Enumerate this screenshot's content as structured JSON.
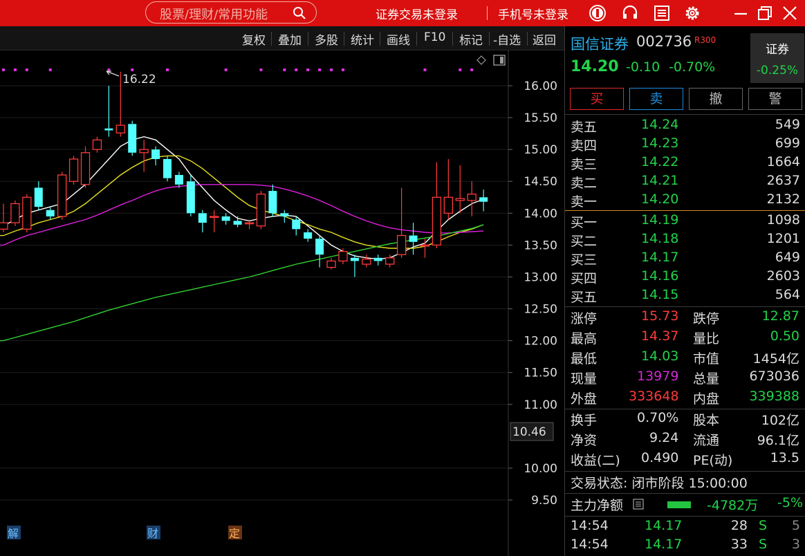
{
  "topbar": {
    "search_placeholder": "股票/理财/常用功能",
    "trade_login": "证券交易未登录",
    "phone_login": "手机号未登录",
    "icons": [
      "logo-icon",
      "headset-icon",
      "menu-icon",
      "gear-icon",
      "minimize-icon",
      "restore-icon",
      "close-icon"
    ]
  },
  "toolbar": {
    "buttons": [
      "复权",
      "叠加",
      "多股",
      "统计",
      "画线",
      "F10",
      "标记",
      "-自选",
      "返回"
    ]
  },
  "chart_data": {
    "type": "candlestick",
    "ylim": [
      9.3,
      16.5
    ],
    "y_ticks": [
      "16.00",
      "15.50",
      "15.00",
      "14.50",
      "14.00",
      "13.50",
      "13.00",
      "12.50",
      "12.00",
      "11.50",
      "11.00",
      "10.00",
      "9.50"
    ],
    "price_marker": "10.46",
    "high_annotation": "16.22",
    "event_markers": [
      "解",
      "财",
      "定"
    ],
    "candles": [
      {
        "o": 13.75,
        "c": 13.85,
        "h": 14.15,
        "l": 13.7
      },
      {
        "o": 13.85,
        "c": 14.15,
        "h": 14.2,
        "l": 13.8
      },
      {
        "o": 13.75,
        "c": 14.25,
        "h": 14.3,
        "l": 13.7
      },
      {
        "o": 14.4,
        "c": 14.1,
        "h": 14.5,
        "l": 14.05
      },
      {
        "o": 14.05,
        "c": 13.95,
        "h": 14.1,
        "l": 13.9
      },
      {
        "o": 13.95,
        "c": 14.6,
        "h": 14.65,
        "l": 13.9
      },
      {
        "o": 14.5,
        "c": 14.85,
        "h": 14.9,
        "l": 14.45
      },
      {
        "o": 14.45,
        "c": 14.95,
        "h": 15.05,
        "l": 14.4
      },
      {
        "o": 15.0,
        "c": 15.15,
        "h": 15.2,
        "l": 14.95
      },
      {
        "o": 15.33,
        "c": 15.3,
        "h": 16.0,
        "l": 15.2
      },
      {
        "o": 15.26,
        "c": 15.38,
        "h": 16.22,
        "l": 15.2
      },
      {
        "o": 15.4,
        "c": 14.95,
        "h": 15.45,
        "l": 14.9
      },
      {
        "o": 14.95,
        "c": 15.0,
        "h": 15.15,
        "l": 14.65
      },
      {
        "o": 15.0,
        "c": 14.85,
        "h": 15.05,
        "l": 14.75
      },
      {
        "o": 14.85,
        "c": 14.55,
        "h": 14.9,
        "l": 14.5
      },
      {
        "o": 14.6,
        "c": 14.45,
        "h": 14.65,
        "l": 14.4
      },
      {
        "o": 14.5,
        "c": 14.0,
        "h": 14.6,
        "l": 13.95
      },
      {
        "o": 14.0,
        "c": 13.85,
        "h": 14.05,
        "l": 13.7
      },
      {
        "o": 13.95,
        "c": 13.95,
        "h": 14.05,
        "l": 13.7
      },
      {
        "o": 13.95,
        "c": 13.88,
        "h": 14.0,
        "l": 13.82
      },
      {
        "o": 13.88,
        "c": 13.82,
        "h": 13.95,
        "l": 13.78
      },
      {
        "o": 13.85,
        "c": 13.85,
        "h": 13.9,
        "l": 13.75
      },
      {
        "o": 13.8,
        "c": 14.3,
        "h": 14.35,
        "l": 13.75
      },
      {
        "o": 14.35,
        "c": 14.0,
        "h": 14.45,
        "l": 13.95
      },
      {
        "o": 14.0,
        "c": 13.95,
        "h": 14.05,
        "l": 13.85
      },
      {
        "o": 13.9,
        "c": 13.75,
        "h": 13.95,
        "l": 13.65
      },
      {
        "o": 13.7,
        "c": 13.6,
        "h": 13.75,
        "l": 13.55
      },
      {
        "o": 13.6,
        "c": 13.35,
        "h": 13.65,
        "l": 13.15
      },
      {
        "o": 13.15,
        "c": 13.25,
        "h": 13.3,
        "l": 13.12
      },
      {
        "o": 13.25,
        "c": 13.4,
        "h": 13.45,
        "l": 13.2
      },
      {
        "o": 13.3,
        "c": 13.25,
        "h": 13.35,
        "l": 13.0
      },
      {
        "o": 13.2,
        "c": 13.28,
        "h": 13.35,
        "l": 13.15
      },
      {
        "o": 13.3,
        "c": 13.25,
        "h": 13.35,
        "l": 13.18
      },
      {
        "o": 13.2,
        "c": 13.3,
        "h": 13.35,
        "l": 13.15
      },
      {
        "o": 13.35,
        "c": 13.65,
        "h": 14.4,
        "l": 13.3
      },
      {
        "o": 13.65,
        "c": 13.55,
        "h": 13.85,
        "l": 13.35
      },
      {
        "o": 13.5,
        "c": 13.5,
        "h": 13.6,
        "l": 13.3
      },
      {
        "o": 13.5,
        "c": 14.25,
        "h": 14.8,
        "l": 13.45
      },
      {
        "o": 14.0,
        "c": 14.25,
        "h": 14.85,
        "l": 13.9
      },
      {
        "o": 14.2,
        "c": 14.23,
        "h": 14.75,
        "l": 14.0
      },
      {
        "o": 14.2,
        "c": 14.3,
        "h": 14.5,
        "l": 13.95
      },
      {
        "o": 14.25,
        "c": 14.18,
        "h": 14.37,
        "l": 14.03
      }
    ],
    "series": [
      {
        "name": "MA5",
        "color": "#ffffff",
        "values": [
          13.8,
          13.9,
          14.0,
          14.05,
          14.1,
          14.15,
          14.3,
          14.45,
          14.65,
          14.85,
          15.05,
          15.15,
          15.2,
          15.15,
          15.0,
          14.85,
          14.6,
          14.4,
          14.2,
          14.05,
          13.92,
          13.88,
          13.92,
          13.95,
          13.97,
          13.95,
          13.8,
          13.65,
          13.5,
          13.4,
          13.33,
          13.3,
          13.28,
          13.3,
          13.38,
          13.47,
          13.53,
          13.72,
          13.9,
          14.03,
          14.15,
          14.22
        ]
      },
      {
        "name": "MA10",
        "color": "#e8e020",
        "values": [
          13.65,
          13.72,
          13.78,
          13.85,
          13.9,
          13.95,
          14.03,
          14.15,
          14.3,
          14.45,
          14.6,
          14.72,
          14.82,
          14.88,
          14.9,
          14.9,
          14.82,
          14.7,
          14.55,
          14.4,
          14.25,
          14.12,
          14.05,
          14.0,
          13.95,
          13.88,
          13.82,
          13.75,
          13.7,
          13.62,
          13.55,
          13.5,
          13.47,
          13.45,
          13.45,
          13.45,
          13.48,
          13.55,
          13.63,
          13.7,
          13.75,
          13.82
        ]
      },
      {
        "name": "MA20",
        "color": "#e020e0",
        "values": [
          13.5,
          13.58,
          13.65,
          13.7,
          13.75,
          13.8,
          13.85,
          13.9,
          13.97,
          14.05,
          14.13,
          14.2,
          14.28,
          14.35,
          14.4,
          14.42,
          14.44,
          14.45,
          14.45,
          14.45,
          14.45,
          14.45,
          14.44,
          14.42,
          14.38,
          14.33,
          14.27,
          14.2,
          14.12,
          14.03,
          13.95,
          13.88,
          13.82,
          13.77,
          13.74,
          13.72,
          13.7,
          13.69,
          13.69,
          13.7,
          13.71,
          13.72
        ]
      },
      {
        "name": "MA60",
        "color": "#32d232",
        "values": [
          12.0,
          12.05,
          12.1,
          12.15,
          12.2,
          12.25,
          12.3,
          12.36,
          12.42,
          12.48,
          12.53,
          12.58,
          12.63,
          12.68,
          12.72,
          12.76,
          12.8,
          12.84,
          12.88,
          12.92,
          12.96,
          13.0,
          13.05,
          13.1,
          13.15,
          13.2,
          13.24,
          13.28,
          13.32,
          13.36,
          13.4,
          13.44,
          13.48,
          13.52,
          13.55,
          13.58,
          13.61,
          13.64,
          13.68,
          13.72,
          13.76,
          13.82
        ]
      }
    ]
  },
  "quote": {
    "name": "国信证券",
    "code": "002736",
    "tag": "R300",
    "price": "14.20",
    "change": "-0.10",
    "change_pct": "-0.70%",
    "sector_name": "证券",
    "sector_pct": "-0.25%"
  },
  "actions": {
    "buy": "买",
    "sell": "卖",
    "cancel": "撤",
    "alert": "警"
  },
  "order_book": {
    "asks": [
      {
        "label": "卖五",
        "price": "14.24",
        "vol": "549"
      },
      {
        "label": "卖四",
        "price": "14.23",
        "vol": "699"
      },
      {
        "label": "卖三",
        "price": "14.22",
        "vol": "1664"
      },
      {
        "label": "卖二",
        "price": "14.21",
        "vol": "2637"
      },
      {
        "label": "卖一",
        "price": "14.20",
        "vol": "2132"
      }
    ],
    "bids": [
      {
        "label": "买一",
        "price": "14.19",
        "vol": "1098"
      },
      {
        "label": "买二",
        "price": "14.18",
        "vol": "1201"
      },
      {
        "label": "买三",
        "price": "14.17",
        "vol": "649"
      },
      {
        "label": "买四",
        "price": "14.16",
        "vol": "2603"
      },
      {
        "label": "买五",
        "price": "14.15",
        "vol": "564"
      }
    ]
  },
  "stats": {
    "limit_up_label": "涨停",
    "limit_up": "15.73",
    "limit_down_label": "跌停",
    "limit_down": "12.87",
    "high_label": "最高",
    "high": "14.37",
    "vol_ratio_label": "量比",
    "vol_ratio": "0.50",
    "low_label": "最低",
    "low": "14.03",
    "mkt_cap_label": "市值",
    "mkt_cap": "1454亿",
    "cur_vol_label": "现量",
    "cur_vol": "13979",
    "total_vol_label": "总量",
    "total_vol": "673036",
    "outer_label": "外盘",
    "outer": "333648",
    "inner_label": "内盘",
    "inner": "339388",
    "turnover_label": "换手",
    "turnover": "0.70%",
    "share_cap_label": "股本",
    "share_cap": "102亿",
    "nav_label": "净资",
    "nav": "9.24",
    "float_label": "流通",
    "float_cap": "96.1亿",
    "eps_label": "收益(二)",
    "eps": "0.490",
    "pe_label": "PE(动)",
    "pe": "13.5"
  },
  "status": {
    "trade_status": "交易状态: 闭市阶段 15:00:00",
    "fund_label": "主力净额",
    "fund_value": "-4782万",
    "fund_pct": "-5%"
  },
  "ticks": [
    {
      "time": "14:54",
      "price": "14.17",
      "vol": "28",
      "side": "S",
      "count": "5"
    },
    {
      "time": "14:54",
      "price": "14.17",
      "vol": "33",
      "side": "S",
      "count": "3"
    }
  ]
}
